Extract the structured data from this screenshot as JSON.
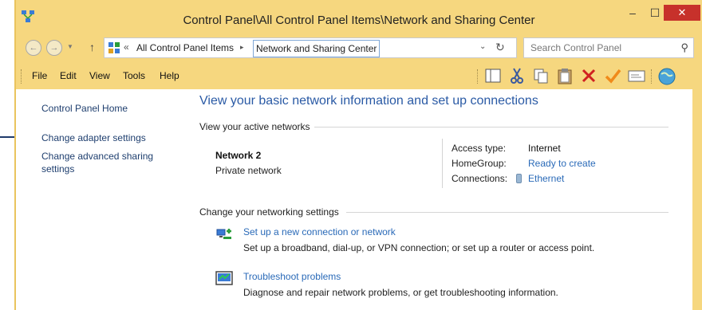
{
  "window": {
    "title": "Control Panel\\All Control Panel Items\\Network and Sharing Center",
    "minimize": "–",
    "maximize": "☐",
    "close": "✕"
  },
  "address": {
    "back": "←",
    "forward": "→",
    "up": "↑",
    "sep": "«",
    "crumb1": "All Control Panel Items",
    "crumb_arrow": "▸",
    "current": "Network and Sharing Center",
    "dropdown": "⌄",
    "refresh": "↻"
  },
  "search": {
    "placeholder": "Search Control Panel",
    "icon": "⚲"
  },
  "menu": {
    "file": "File",
    "edit": "Edit",
    "view": "View",
    "tools": "Tools",
    "help": "Help"
  },
  "toolbar_icons": [
    "layout-icon",
    "cut-icon",
    "copy-icon",
    "paste-icon",
    "delete-icon",
    "check-icon",
    "properties-icon",
    "globe-icon"
  ],
  "sidebar": {
    "home": "Control Panel Home",
    "adapter": "Change adapter settings",
    "advanced_line1": "Change advanced sharing",
    "advanced_line2": "settings"
  },
  "main": {
    "heading": "View your basic network information and set up connections",
    "active_networks": "View your active networks",
    "network_name": "Network  2",
    "network_type": "Private network",
    "access_type_label": "Access type:",
    "access_type_value": "Internet",
    "homegroup_label": "HomeGroup:",
    "homegroup_value": "Ready to create",
    "connections_label": "Connections:",
    "connections_value": "Ethernet",
    "change_settings": "Change your networking settings",
    "task1_link": "Set up a new connection or network",
    "task1_desc": "Set up a broadband, dial-up, or VPN connection; or set up a router or access point.",
    "task2_link": "Troubleshoot problems",
    "task2_desc": "Diagnose and repair network problems, or get troubleshooting information."
  },
  "colors": {
    "frame": "#f6d77f",
    "link": "#2a6ab8",
    "heading": "#2a5aa5",
    "close": "#c7312b"
  }
}
